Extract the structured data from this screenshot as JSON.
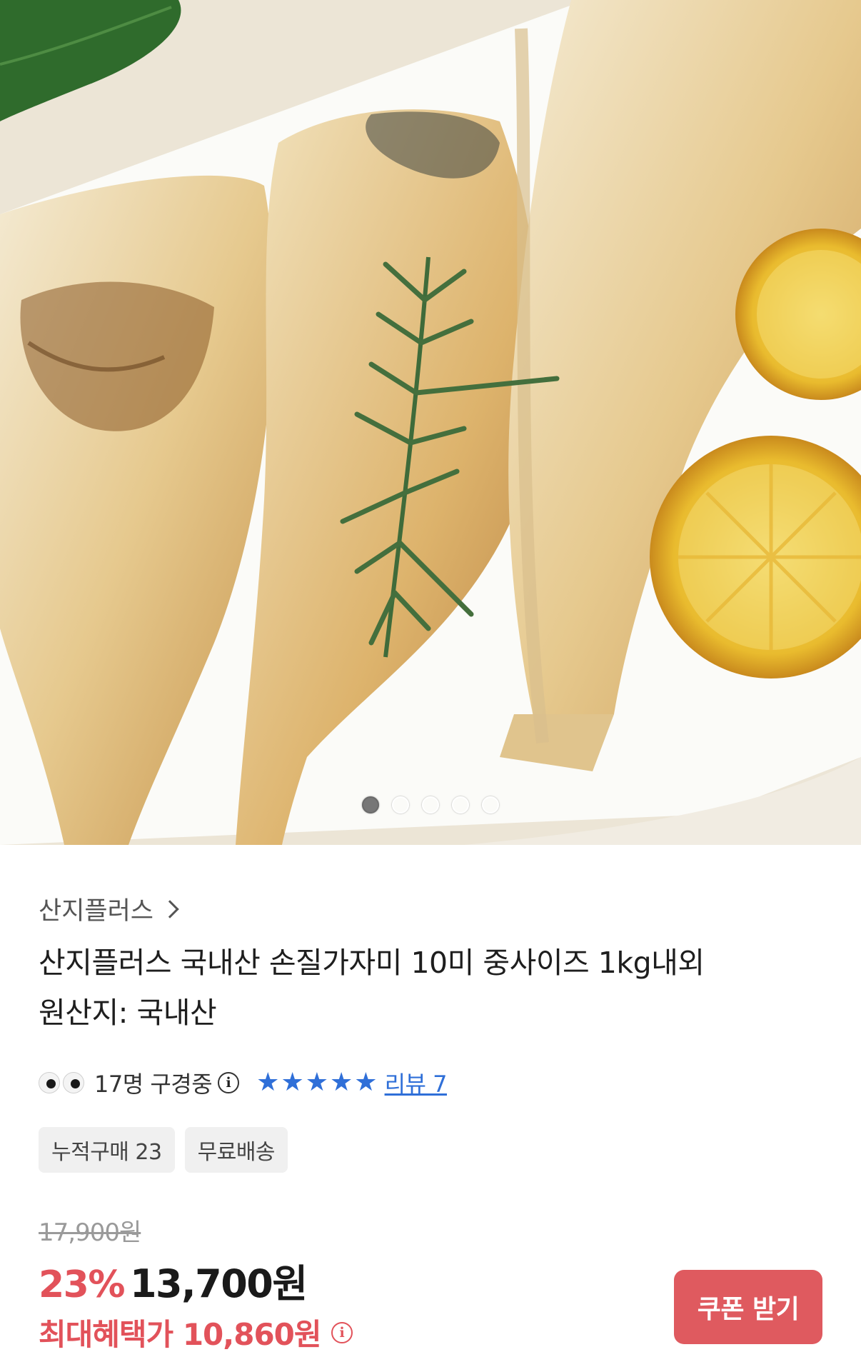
{
  "gallery": {
    "image_alt": "구운 가자미 요리 이미지",
    "slide_count": 5,
    "active_slide": 1
  },
  "product": {
    "brand": "산지플러스",
    "title_line1": "산지플러스 국내산 손질가자미 10미 중사이즈 1kg내외",
    "title_line2": "원산지: 국내산",
    "viewing_text": "17명 구경중",
    "rating_stars": 5,
    "review_label": "리뷰 7",
    "chips": [
      "누적구매 23",
      "무료배송"
    ],
    "original_price": "17,900원",
    "discount_rate": "23%",
    "sale_price": "13,700원",
    "max_benefit_label": "최대혜택가 10,860원",
    "coupon_button": "쿠폰 받기"
  },
  "colors": {
    "accent_red": "#e2525a",
    "link_blue": "#2f6fd8",
    "coupon_button": "#df5a5f"
  }
}
